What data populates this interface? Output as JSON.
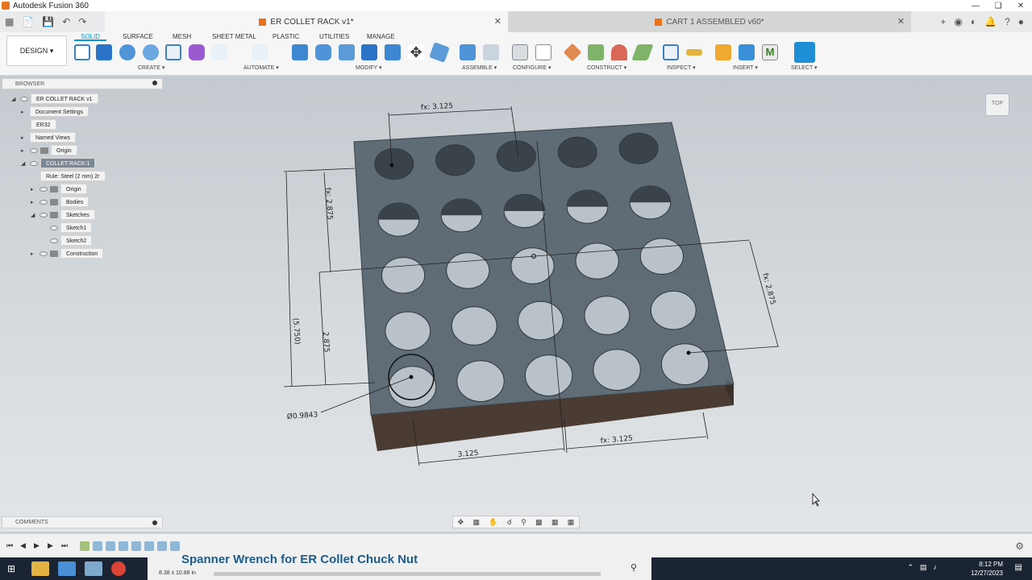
{
  "window": {
    "title": "Autodesk Fusion 360"
  },
  "tabs": {
    "active_doc": "ER COLLET RACK v1*",
    "other_doc": "CART 1 ASSEMBLED v60*"
  },
  "toolbar": {
    "workspace": "DESIGN",
    "ws_tabs": [
      "SOLID",
      "SURFACE",
      "MESH",
      "SHEET METAL",
      "PLASTIC",
      "UTILITIES",
      "MANAGE"
    ],
    "groups": [
      "CREATE",
      "AUTOMATE",
      "MODIFY",
      "ASSEMBLE",
      "CONFIGURE",
      "CONSTRUCT",
      "INSPECT",
      "INSERT",
      "SELECT"
    ]
  },
  "browser": {
    "title": "BROWSER",
    "items": [
      {
        "label": "ER COLLET RACK v1"
      },
      {
        "label": "Document Settings"
      },
      {
        "label": "ER32"
      },
      {
        "label": "Named Views"
      },
      {
        "label": "Origin"
      },
      {
        "label": "COLLET RACK:1"
      },
      {
        "label": "Rule: Steel (2 mm) 2r"
      },
      {
        "label": "Origin"
      },
      {
        "label": "Bodies"
      },
      {
        "label": "Sketches"
      },
      {
        "label": "Sketch1"
      },
      {
        "label": "Sketch2"
      },
      {
        "label": "Construction"
      }
    ]
  },
  "comments": {
    "title": "COMMENTS"
  },
  "dimensions": {
    "top": "fx: 3.125",
    "left_upper": "fx: 2.875",
    "left_total": "(5.750)",
    "left_lower": "2.875",
    "right": "fx: 2.875",
    "bottom_left": "3.125",
    "bottom_right": "fx: 3.125",
    "diameter": "Ø0.9843"
  },
  "viewcube": {
    "face": "TOP"
  },
  "taskbar": {
    "video_title": "Spanner Wrench for ER Collet Chuck Nut",
    "dims": "8.38 x 10.88 in",
    "time": "8:12 PM",
    "date": "12/27/2023"
  },
  "colors": {
    "accent": "#0696d7",
    "block_top": "#4f5d67",
    "block_front": "#4a3b33"
  }
}
